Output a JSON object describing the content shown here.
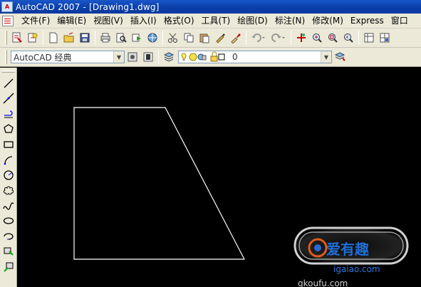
{
  "window": {
    "title": "AutoCAD 2007 - [Drawing1.dwg]",
    "app_icon_text": "A"
  },
  "menu": {
    "items": [
      "文件(F)",
      "编辑(E)",
      "视图(V)",
      "插入(I)",
      "格式(O)",
      "工具(T)",
      "绘图(D)",
      "标注(N)",
      "修改(M)",
      "Express",
      "窗口"
    ]
  },
  "toolbar": {
    "standard_icons": [
      "new-icon",
      "open-icon",
      "save-icon",
      "plot-icon",
      "plot-preview-icon",
      "publish-icon",
      "3d-dwf-icon",
      "cut-icon",
      "copy-icon",
      "paste-icon",
      "match-properties-icon",
      "block-editor-icon",
      "undo-icon",
      "redo-icon",
      "pan-icon",
      "zoom-realtime-icon",
      "zoom-window-icon",
      "zoom-previous-icon",
      "properties-icon",
      "design-center-icon"
    ]
  },
  "workspace": {
    "value": "AutoCAD 经典"
  },
  "layer": {
    "value": "0"
  },
  "draw_toolbar": {
    "icons": [
      "line-icon",
      "construction-line-icon",
      "polyline-icon",
      "polygon-icon",
      "rectangle-icon",
      "arc-icon",
      "circle-icon",
      "revision-cloud-icon",
      "spline-icon",
      "ellipse-icon",
      "ellipse-arc-icon",
      "insert-block-icon",
      "make-block-icon"
    ]
  },
  "drawing": {
    "shape": "trapezoid",
    "stroke_color": "#ffffff",
    "background": "#000000"
  },
  "watermark": {
    "text": "爱有趣的 igaiao.com",
    "url_text": "igaiao.com",
    "subtext": "qkoufu.com"
  },
  "colors": {
    "titlebar": "#0a3ea8",
    "chrome": "#ece9d8",
    "canvas": "#000000"
  }
}
